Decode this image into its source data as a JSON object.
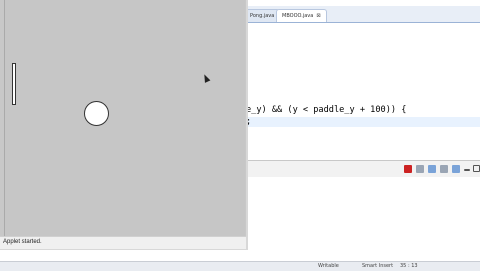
{
  "editor": {
    "tabs": [
      {
        "label": "Pong.java"
      },
      {
        "label": "MBOOO.java",
        "close": "⊠"
      }
    ],
    "code": {
      "line1": "e_y) && (y < paddle_y + 100)) {",
      "line2": ";"
    }
  },
  "applet": {
    "status": "Applet started."
  },
  "status_bar": {
    "mode": "Writable",
    "insert": "Smart Insert",
    "position": "35 : 13"
  },
  "colors": {
    "stop": "#cc2222",
    "view_icon": "#7aa3d8"
  },
  "icons": [
    "stop-icon",
    "clear-icon",
    "scroll-lock-icon",
    "pin-icon",
    "display-console-icon",
    "minimize-icon",
    "maximize-icon"
  ]
}
